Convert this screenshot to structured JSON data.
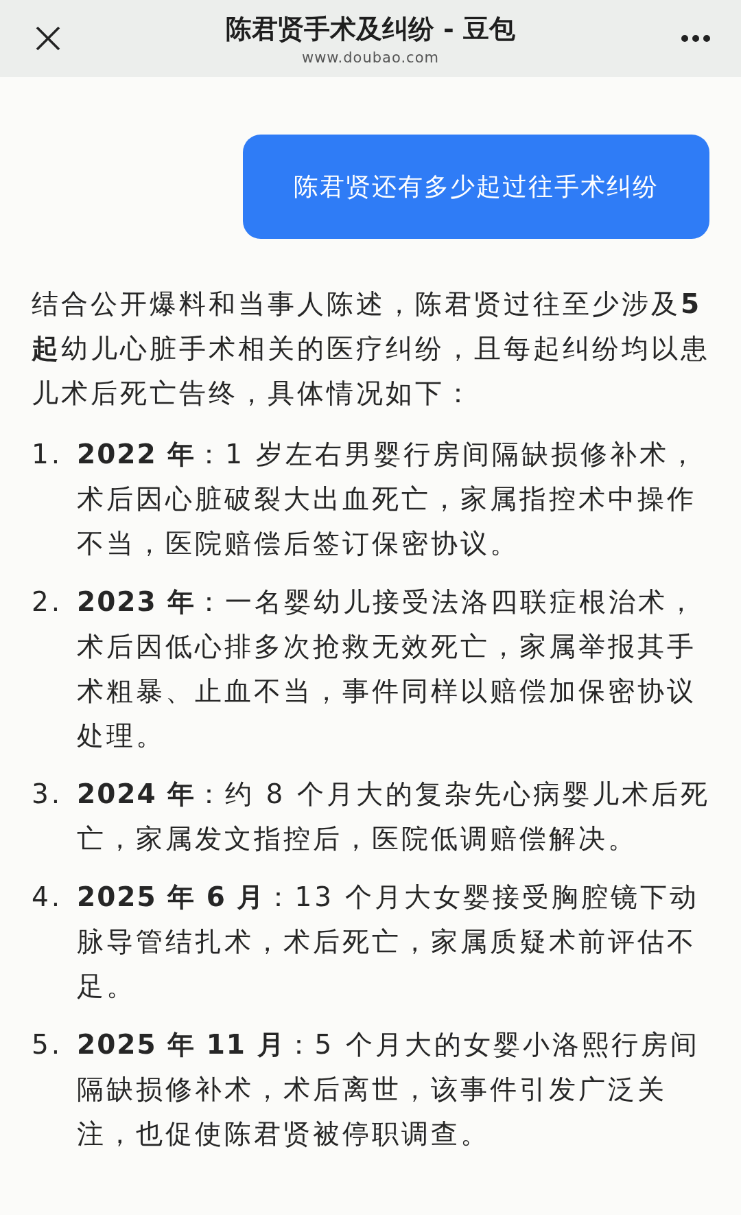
{
  "header": {
    "title": "陈君贤手术及纠纷 - 豆包",
    "url": "www.doubao.com"
  },
  "user_message": "陈君贤还有多少起过往手术纠纷",
  "reply": {
    "intro": "结合公开爆料和当事人陈述，陈君贤过往至少涉及**5 起**幼儿心脏手术相关的医疗纠纷，且每起纠纷均以患儿术后死亡告终，具体情况如下：",
    "items": [
      {
        "number": "1.",
        "text": "**2022 年**：1 岁左右男婴行房间隔缺损修补术，术后因心脏破裂大出血死亡，家属指控术中操作不当，医院赔偿后签订保密协议。"
      },
      {
        "number": "2.",
        "text": "**2023 年**：一名婴幼儿接受法洛四联症根治术，术后因低心排多次抢救无效死亡，家属举报其手术粗暴、止血不当，事件同样以赔偿加保密协议处理。"
      },
      {
        "number": "3.",
        "text": "**2024 年**：约 8 个月大的复杂先心病婴儿术后死亡，家属发文指控后，医院低调赔偿解决。"
      },
      {
        "number": "4.",
        "text": "**2025 年 6 月**：13 个月大女婴接受胸腔镜下动脉导管结扎术，术后死亡，家属质疑术前评估不足。"
      },
      {
        "number": "5.",
        "text": "**2025 年 11 月**：5 个月大的女婴小洛熙行房间隔缺损修补术，术后离世，该事件引发广泛关注，也促使陈君贤被停职调查。"
      }
    ]
  }
}
